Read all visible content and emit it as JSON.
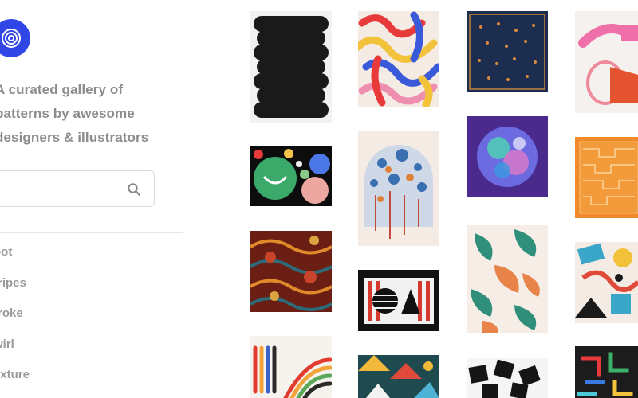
{
  "sidebar": {
    "logo_icon": "spiral-logo-icon",
    "tagline": [
      "A curated gallery of",
      "patterns by awesome",
      "designers & illustrators"
    ],
    "search": {
      "placeholder": "",
      "value": "",
      "icon": "search-icon"
    },
    "categories": [
      {
        "label": "pot"
      },
      {
        "label": "tripes"
      },
      {
        "label": "troke"
      },
      {
        "label": "wirl"
      },
      {
        "label": "exture"
      }
    ]
  },
  "colors": {
    "accent": "#3046e6",
    "muted_text": "#8c8c8c",
    "border": "#e6e6e6"
  },
  "gallery": [
    {
      "id": "black-wavy-stack",
      "kind": "image"
    },
    {
      "id": "colorful-squiggles",
      "kind": "image"
    },
    {
      "id": "navy-scarf-dots",
      "kind": "image"
    },
    {
      "id": "pink-abstract-shapes",
      "kind": "image"
    },
    {
      "id": "smiley-circles",
      "kind": "image"
    },
    {
      "id": "splatter-arch",
      "kind": "image"
    },
    {
      "id": "purple-planet",
      "kind": "image"
    },
    {
      "id": "orange-maze",
      "kind": "image"
    },
    {
      "id": "ornate-paisley",
      "kind": "image"
    },
    {
      "id": "black-white-stripes",
      "kind": "image"
    },
    {
      "id": "leafy-mural",
      "kind": "image"
    },
    {
      "id": "memphis-collage",
      "kind": "image"
    },
    {
      "id": "rainbow-arches",
      "kind": "image"
    },
    {
      "id": "geometric-triangles",
      "kind": "image"
    },
    {
      "id": "black-paint-blocks",
      "kind": "image"
    },
    {
      "id": "tetris-blocks",
      "kind": "image"
    }
  ]
}
